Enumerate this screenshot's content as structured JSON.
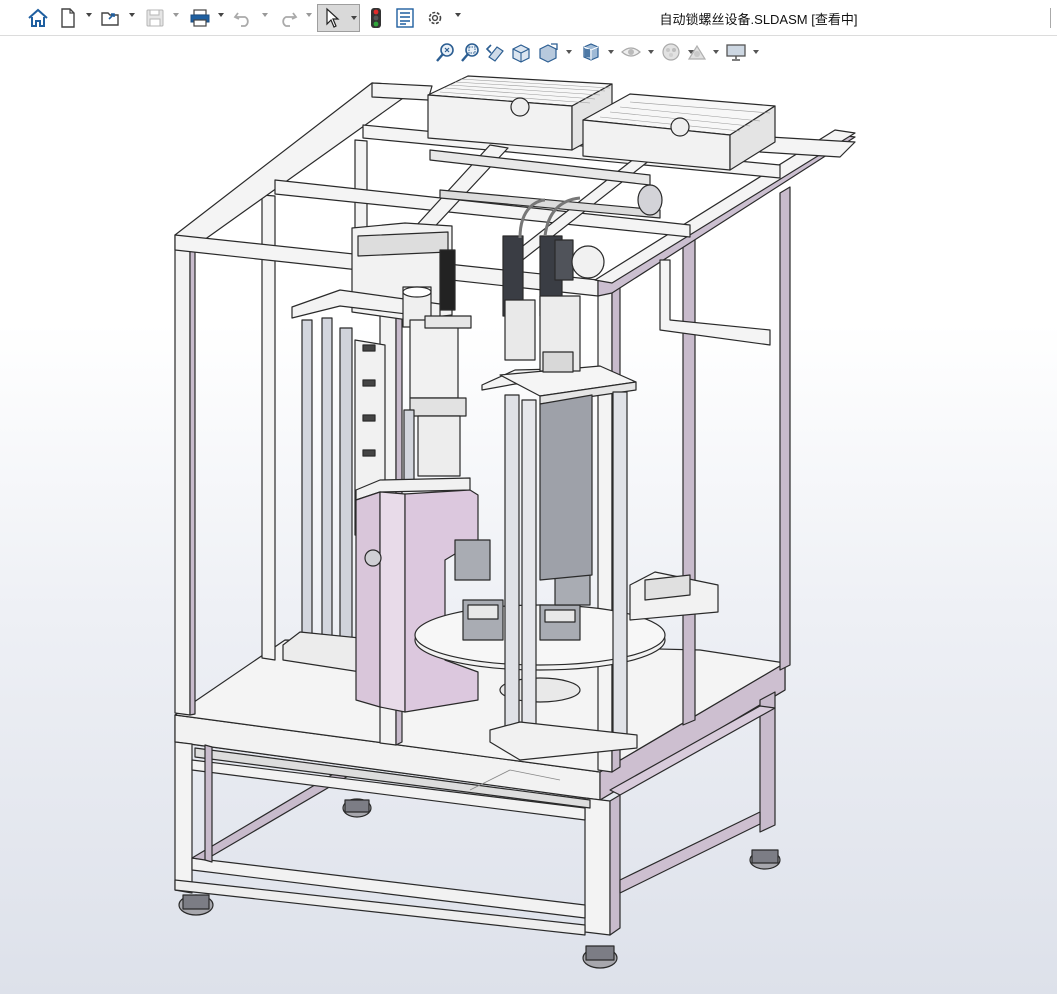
{
  "window": {
    "title": "自动锁螺丝设备.SLDASM [查看中]"
  },
  "toolbar": {
    "buttons": [
      {
        "icon": "home-icon"
      },
      {
        "icon": "new-document-icon",
        "has_dropdown": true
      },
      {
        "icon": "open-folder-icon",
        "has_dropdown": true
      },
      {
        "icon": "save-icon",
        "has_dropdown": true,
        "enabled": false
      },
      {
        "icon": "print-icon",
        "has_dropdown": true
      },
      {
        "icon": "undo-icon",
        "has_dropdown": true,
        "enabled": false
      },
      {
        "icon": "redo-icon",
        "has_dropdown": true,
        "enabled": false
      },
      {
        "icon": "select-pointer-icon",
        "has_dropdown": true,
        "active": true
      },
      {
        "icon": "traffic-light-icon"
      },
      {
        "icon": "file-properties-icon"
      },
      {
        "icon": "options-gear-icon",
        "has_dropdown": true
      }
    ]
  },
  "heads_up_toolbar": {
    "buttons": [
      {
        "icon": "zoom-to-fit-icon"
      },
      {
        "icon": "zoom-to-area-icon"
      },
      {
        "icon": "previous-view-icon"
      },
      {
        "icon": "section-view-icon"
      },
      {
        "icon": "dynamic-annotation-icon",
        "has_dropdown": true
      },
      {
        "icon": "view-orientation-cube-icon",
        "has_dropdown": true
      },
      {
        "icon": "hide-show-items-icon",
        "has_dropdown": true
      },
      {
        "icon": "edit-appearance-icon",
        "has_dropdown": true
      },
      {
        "icon": "apply-scene-icon",
        "has_dropdown": true
      },
      {
        "icon": "view-settings-monitor-icon",
        "has_dropdown": true
      }
    ]
  },
  "viewport": {
    "content": "3d-assembly-model",
    "colors": {
      "frame_face": "#f4f4f4",
      "frame_side": "#cbbecf",
      "frame_outline": "#2a2a2a",
      "plate_purple": "#d8c3d8",
      "steel_gray": "#9da0a8",
      "background_top": "#ffffff",
      "background_bottom": "#dde1ea"
    }
  }
}
